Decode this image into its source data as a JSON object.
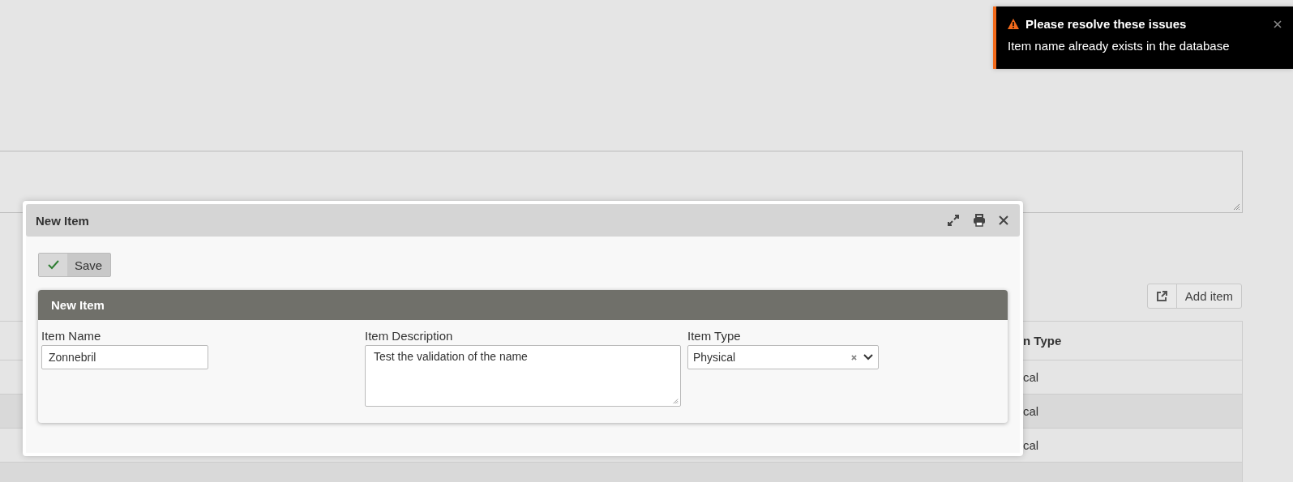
{
  "background": {
    "add_button": {
      "label": "Add item"
    },
    "table": {
      "columns": [
        "n Type"
      ],
      "rows": [
        [
          "cal"
        ],
        [
          "cal"
        ],
        [
          "cal"
        ]
      ]
    }
  },
  "dialog": {
    "title": "New Item",
    "save_button": "Save",
    "section": {
      "title": "New Item",
      "fields": [
        {
          "kind": "text",
          "label": "Item Name",
          "value": "Zonnebril"
        },
        {
          "kind": "textarea",
          "label": "Item Description",
          "value": "Test the validation of the name"
        },
        {
          "kind": "select",
          "label": "Item Type",
          "value": "Physical"
        }
      ]
    }
  },
  "toast": {
    "title": "Please resolve these issues",
    "message": "Item name already exists in the database"
  }
}
